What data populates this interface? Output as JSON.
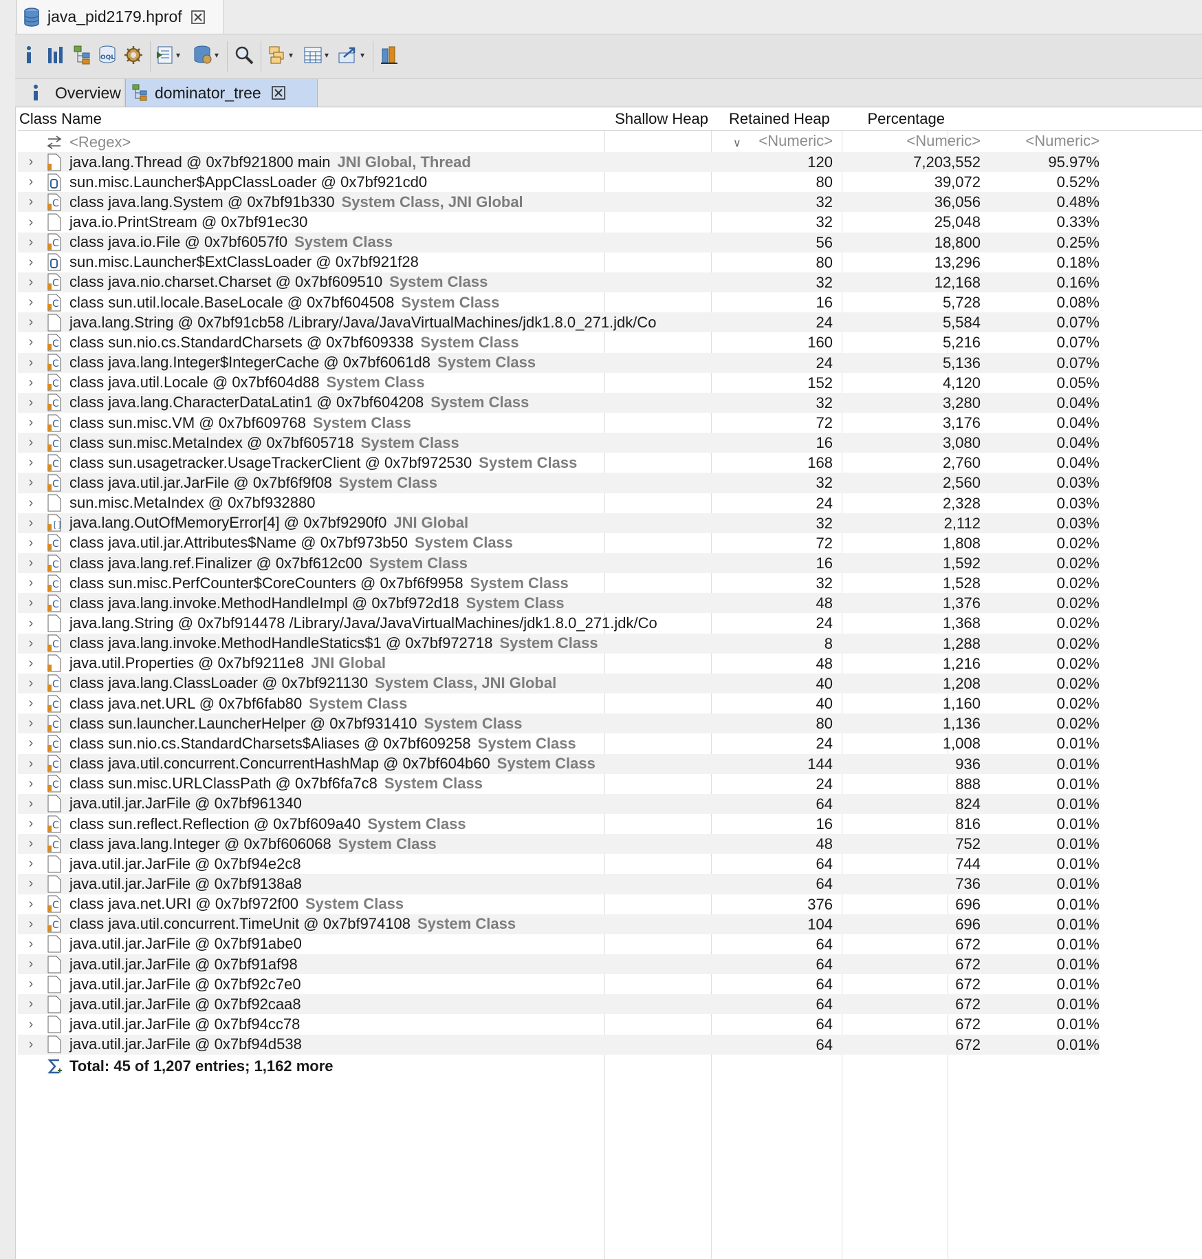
{
  "file_tab": {
    "title": "java_pid2179.hprof"
  },
  "toolbar": {
    "icons": [
      "info-icon",
      "histogram-icon",
      "dominator-tree-icon",
      "oql-icon",
      "heap-dump-details-icon",
      "run-report-icon",
      "query-browser-icon",
      "search-icon",
      "group-by-icon",
      "calculate-retained-size-icon",
      "export-icon",
      "pin-icon"
    ]
  },
  "subtabs": {
    "overview": "Overview",
    "dominator": "dominator_tree"
  },
  "columns": {
    "name": "Class Name",
    "shallow": "Shallow Heap",
    "retained": "Retained Heap",
    "percentage": "Percentage"
  },
  "filter": {
    "regex": "<Regex>",
    "shallow": "<Numeric>",
    "retained": "<Numeric>",
    "percentage": "<Numeric>"
  },
  "rows": [
    {
      "icon": "obj",
      "text": "java.lang.Thread @ 0x7bf921800  main",
      "tag": "JNI Global, Thread",
      "shallow": "120",
      "retained": "7,203,552",
      "pct": "95.97%"
    },
    {
      "icon": "loader",
      "text": "sun.misc.Launcher$AppClassLoader @ 0x7bf921cd0",
      "tag": "",
      "shallow": "80",
      "retained": "39,072",
      "pct": "0.52%"
    },
    {
      "icon": "class",
      "text": "class java.lang.System @ 0x7bf91b330",
      "tag": "System Class, JNI Global",
      "shallow": "32",
      "retained": "36,056",
      "pct": "0.48%"
    },
    {
      "icon": "plain",
      "text": "java.io.PrintStream @ 0x7bf91ec30",
      "tag": "",
      "shallow": "32",
      "retained": "25,048",
      "pct": "0.33%"
    },
    {
      "icon": "class",
      "text": "class java.io.File @ 0x7bf6057f0",
      "tag": "System Class",
      "shallow": "56",
      "retained": "18,800",
      "pct": "0.25%"
    },
    {
      "icon": "loader",
      "text": "sun.misc.Launcher$ExtClassLoader @ 0x7bf921f28",
      "tag": "",
      "shallow": "80",
      "retained": "13,296",
      "pct": "0.18%"
    },
    {
      "icon": "class",
      "text": "class java.nio.charset.Charset @ 0x7bf609510",
      "tag": "System Class",
      "shallow": "32",
      "retained": "12,168",
      "pct": "0.16%"
    },
    {
      "icon": "class",
      "text": "class sun.util.locale.BaseLocale @ 0x7bf604508",
      "tag": "System Class",
      "shallow": "16",
      "retained": "5,728",
      "pct": "0.08%"
    },
    {
      "icon": "plain",
      "text": "java.lang.String @ 0x7bf91cb58  /Library/Java/JavaVirtualMachines/jdk1.8.0_271.jdk/Co",
      "tag": "",
      "shallow": "24",
      "retained": "5,584",
      "pct": "0.07%"
    },
    {
      "icon": "class",
      "text": "class sun.nio.cs.StandardCharsets @ 0x7bf609338",
      "tag": "System Class",
      "shallow": "160",
      "retained": "5,216",
      "pct": "0.07%"
    },
    {
      "icon": "class",
      "text": "class java.lang.Integer$IntegerCache @ 0x7bf6061d8",
      "tag": "System Class",
      "shallow": "24",
      "retained": "5,136",
      "pct": "0.07%"
    },
    {
      "icon": "class",
      "text": "class java.util.Locale @ 0x7bf604d88",
      "tag": "System Class",
      "shallow": "152",
      "retained": "4,120",
      "pct": "0.05%"
    },
    {
      "icon": "class",
      "text": "class java.lang.CharacterDataLatin1 @ 0x7bf604208",
      "tag": "System Class",
      "shallow": "32",
      "retained": "3,280",
      "pct": "0.04%"
    },
    {
      "icon": "class",
      "text": "class sun.misc.VM @ 0x7bf609768",
      "tag": "System Class",
      "shallow": "72",
      "retained": "3,176",
      "pct": "0.04%"
    },
    {
      "icon": "class",
      "text": "class sun.misc.MetaIndex @ 0x7bf605718",
      "tag": "System Class",
      "shallow": "16",
      "retained": "3,080",
      "pct": "0.04%"
    },
    {
      "icon": "class",
      "text": "class sun.usagetracker.UsageTrackerClient @ 0x7bf972530",
      "tag": "System Class",
      "shallow": "168",
      "retained": "2,760",
      "pct": "0.04%"
    },
    {
      "icon": "class",
      "text": "class java.util.jar.JarFile @ 0x7bf6f9f08",
      "tag": "System Class",
      "shallow": "32",
      "retained": "2,560",
      "pct": "0.03%"
    },
    {
      "icon": "plain",
      "text": "sun.misc.MetaIndex @ 0x7bf932880",
      "tag": "",
      "shallow": "24",
      "retained": "2,328",
      "pct": "0.03%"
    },
    {
      "icon": "array",
      "text": "java.lang.OutOfMemoryError[4] @ 0x7bf9290f0",
      "tag": "JNI Global",
      "shallow": "32",
      "retained": "2,112",
      "pct": "0.03%"
    },
    {
      "icon": "class",
      "text": "class java.util.jar.Attributes$Name @ 0x7bf973b50",
      "tag": "System Class",
      "shallow": "72",
      "retained": "1,808",
      "pct": "0.02%"
    },
    {
      "icon": "class",
      "text": "class java.lang.ref.Finalizer @ 0x7bf612c00",
      "tag": "System Class",
      "shallow": "16",
      "retained": "1,592",
      "pct": "0.02%"
    },
    {
      "icon": "class",
      "text": "class sun.misc.PerfCounter$CoreCounters @ 0x7bf6f9958",
      "tag": "System Class",
      "shallow": "32",
      "retained": "1,528",
      "pct": "0.02%"
    },
    {
      "icon": "class",
      "text": "class java.lang.invoke.MethodHandleImpl @ 0x7bf972d18",
      "tag": "System Class",
      "shallow": "48",
      "retained": "1,376",
      "pct": "0.02%"
    },
    {
      "icon": "plain",
      "text": "java.lang.String @ 0x7bf914478  /Library/Java/JavaVirtualMachines/jdk1.8.0_271.jdk/Co",
      "tag": "",
      "shallow": "24",
      "retained": "1,368",
      "pct": "0.02%"
    },
    {
      "icon": "class",
      "text": "class java.lang.invoke.MethodHandleStatics$1 @ 0x7bf972718",
      "tag": "System Class",
      "shallow": "8",
      "retained": "1,288",
      "pct": "0.02%"
    },
    {
      "icon": "obj",
      "text": "java.util.Properties @ 0x7bf9211e8",
      "tag": "JNI Global",
      "shallow": "48",
      "retained": "1,216",
      "pct": "0.02%"
    },
    {
      "icon": "class",
      "text": "class java.lang.ClassLoader @ 0x7bf921130",
      "tag": "System Class, JNI Global",
      "shallow": "40",
      "retained": "1,208",
      "pct": "0.02%"
    },
    {
      "icon": "class",
      "text": "class java.net.URL @ 0x7bf6fab80",
      "tag": "System Class",
      "shallow": "40",
      "retained": "1,160",
      "pct": "0.02%"
    },
    {
      "icon": "class",
      "text": "class sun.launcher.LauncherHelper @ 0x7bf931410",
      "tag": "System Class",
      "shallow": "80",
      "retained": "1,136",
      "pct": "0.02%"
    },
    {
      "icon": "class",
      "text": "class sun.nio.cs.StandardCharsets$Aliases @ 0x7bf609258",
      "tag": "System Class",
      "shallow": "24",
      "retained": "1,008",
      "pct": "0.01%"
    },
    {
      "icon": "class",
      "text": "class java.util.concurrent.ConcurrentHashMap @ 0x7bf604b60",
      "tag": "System Class",
      "shallow": "144",
      "retained": "936",
      "pct": "0.01%"
    },
    {
      "icon": "class",
      "text": "class sun.misc.URLClassPath @ 0x7bf6fa7c8",
      "tag": "System Class",
      "shallow": "24",
      "retained": "888",
      "pct": "0.01%"
    },
    {
      "icon": "plain",
      "text": "java.util.jar.JarFile @ 0x7bf961340",
      "tag": "",
      "shallow": "64",
      "retained": "824",
      "pct": "0.01%"
    },
    {
      "icon": "class",
      "text": "class sun.reflect.Reflection @ 0x7bf609a40",
      "tag": "System Class",
      "shallow": "16",
      "retained": "816",
      "pct": "0.01%"
    },
    {
      "icon": "class",
      "text": "class java.lang.Integer @ 0x7bf606068",
      "tag": "System Class",
      "shallow": "48",
      "retained": "752",
      "pct": "0.01%"
    },
    {
      "icon": "plain",
      "text": "java.util.jar.JarFile @ 0x7bf94e2c8",
      "tag": "",
      "shallow": "64",
      "retained": "744",
      "pct": "0.01%"
    },
    {
      "icon": "plain",
      "text": "java.util.jar.JarFile @ 0x7bf9138a8",
      "tag": "",
      "shallow": "64",
      "retained": "736",
      "pct": "0.01%"
    },
    {
      "icon": "class",
      "text": "class java.net.URI @ 0x7bf972f00",
      "tag": "System Class",
      "shallow": "376",
      "retained": "696",
      "pct": "0.01%"
    },
    {
      "icon": "class",
      "text": "class java.util.concurrent.TimeUnit @ 0x7bf974108",
      "tag": "System Class",
      "shallow": "104",
      "retained": "696",
      "pct": "0.01%"
    },
    {
      "icon": "plain",
      "text": "java.util.jar.JarFile @ 0x7bf91abe0",
      "tag": "",
      "shallow": "64",
      "retained": "672",
      "pct": "0.01%"
    },
    {
      "icon": "plain",
      "text": "java.util.jar.JarFile @ 0x7bf91af98",
      "tag": "",
      "shallow": "64",
      "retained": "672",
      "pct": "0.01%"
    },
    {
      "icon": "plain",
      "text": "java.util.jar.JarFile @ 0x7bf92c7e0",
      "tag": "",
      "shallow": "64",
      "retained": "672",
      "pct": "0.01%"
    },
    {
      "icon": "plain",
      "text": "java.util.jar.JarFile @ 0x7bf92caa8",
      "tag": "",
      "shallow": "64",
      "retained": "672",
      "pct": "0.01%"
    },
    {
      "icon": "plain",
      "text": "java.util.jar.JarFile @ 0x7bf94cc78",
      "tag": "",
      "shallow": "64",
      "retained": "672",
      "pct": "0.01%"
    },
    {
      "icon": "plain",
      "text": "java.util.jar.JarFile @ 0x7bf94d538",
      "tag": "",
      "shallow": "64",
      "retained": "672",
      "pct": "0.01%"
    }
  ],
  "total": "Total: 45 of 1,207 entries; 1,162 more",
  "colors": {
    "tag": "#7d7d7d",
    "class_icon": "#d98a1c",
    "selected_tab": "#c7d9f2"
  }
}
